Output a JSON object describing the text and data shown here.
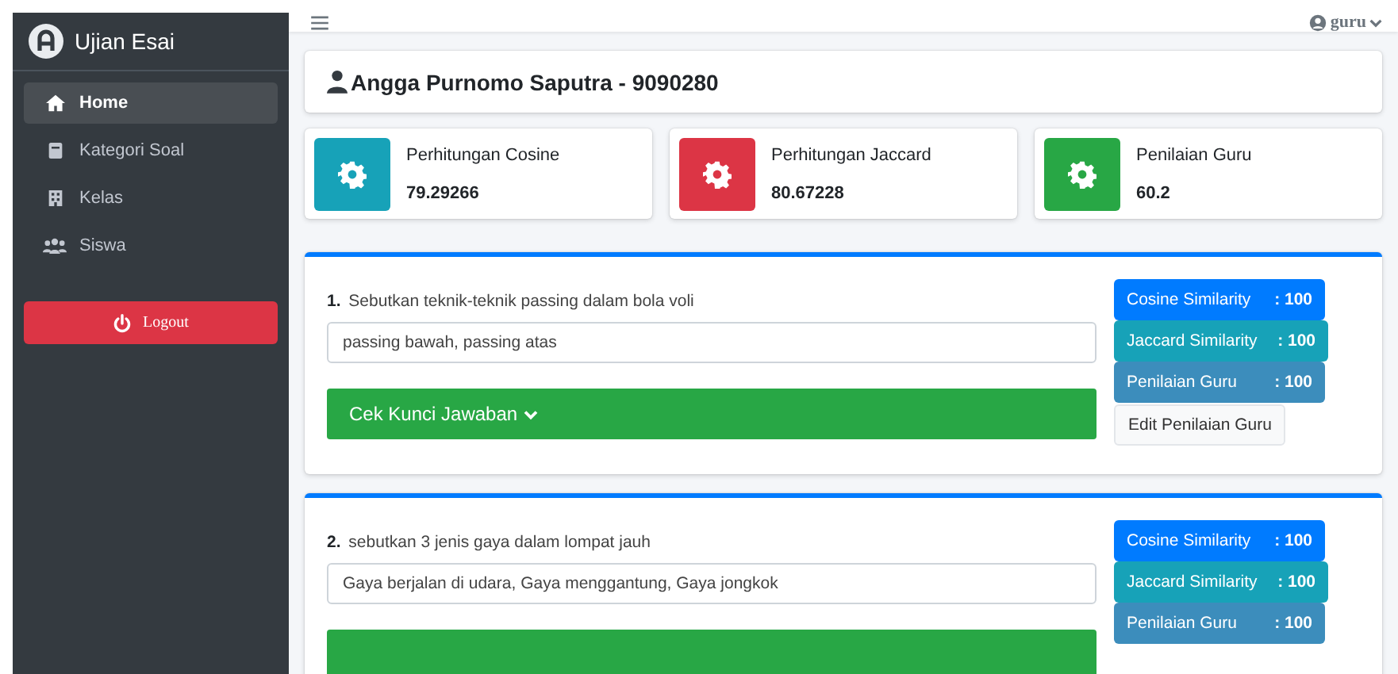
{
  "sidebar": {
    "brand": "Ujian Esai",
    "items": [
      {
        "label": "Home",
        "kind": "home",
        "selected": true
      },
      {
        "label": "Kategori Soal",
        "kind": "category",
        "selected": false
      },
      {
        "label": "Kelas",
        "kind": "class",
        "selected": false
      },
      {
        "label": "Siswa",
        "kind": "student",
        "selected": false
      }
    ],
    "logout": "Logout"
  },
  "navbar": {
    "user": "guru"
  },
  "student": {
    "title": "Angga Purnomo Saputra - 9090280"
  },
  "info_boxes": [
    {
      "label": "Perhitungan Cosine",
      "value": "79.29266",
      "color": "#17a2b8"
    },
    {
      "label": "Perhitungan Jaccard",
      "value": "80.67228",
      "color": "#dc3545"
    },
    {
      "label": "Penilaian Guru",
      "value": "60.2",
      "color": "#28a745"
    }
  ],
  "questions": [
    {
      "number": "1.",
      "text": "Sebutkan teknik-teknik passing dalam bola voli",
      "answer": "passing bawah, passing atas",
      "key_button": "Cek Kunci Jawaban",
      "scores": [
        {
          "kind": "cosine",
          "label": "Cosine Similarity",
          "value": ": 100"
        },
        {
          "kind": "jaccard",
          "label": "Jaccard Similarity",
          "value": ": 100"
        },
        {
          "kind": "guru",
          "label": "Penilaian Guru",
          "value": ": 100"
        }
      ],
      "edit_button": "Edit Penilaian Guru"
    },
    {
      "number": "2.",
      "text": "sebutkan 3 jenis gaya dalam lompat jauh",
      "answer": "Gaya berjalan di udara, Gaya menggantung, Gaya jongkok",
      "scores": [
        {
          "kind": "cosine",
          "label": "Cosine Similarity",
          "value": ": 100"
        },
        {
          "kind": "jaccard",
          "label": "Jaccard Similarity",
          "value": ": 100"
        },
        {
          "kind": "guru",
          "label": "Penilaian Guru",
          "value": ": 100"
        }
      ]
    }
  ]
}
